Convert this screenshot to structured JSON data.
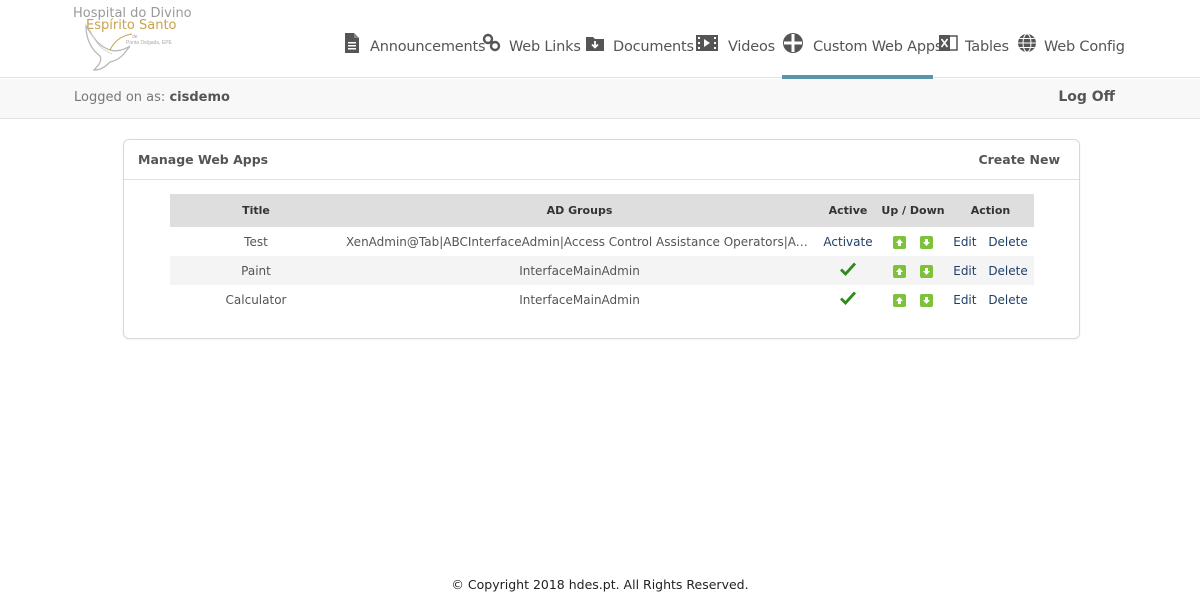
{
  "logo": {
    "line1": "Hospital do Divino",
    "line2": "Espírito Santo",
    "line3": "de",
    "line4": "Ponta Delgada, EPE"
  },
  "nav": [
    {
      "label": "Announcements",
      "icon": "document-icon",
      "active": false
    },
    {
      "label": "Web Links",
      "icon": "link-icon",
      "active": false
    },
    {
      "label": "Documents",
      "icon": "folder-download-icon",
      "active": false
    },
    {
      "label": "Videos",
      "icon": "film-icon",
      "active": false
    },
    {
      "label": "Custom Web Apps",
      "icon": "grid-circle-icon",
      "active": true
    },
    {
      "label": "Tables",
      "icon": "excel-icon",
      "active": false
    },
    {
      "label": "Web Config",
      "icon": "globe-icon",
      "active": false
    }
  ],
  "subheader": {
    "logged_prefix": "Logged on as:",
    "username": "cisdemo",
    "logoff": "Log Off"
  },
  "panel": {
    "title": "Manage Web Apps",
    "create_new": "Create New"
  },
  "table": {
    "headers": [
      "Title",
      "AD Groups",
      "Active",
      "Up / Down",
      "Action"
    ],
    "rows": [
      {
        "title": "Test",
        "groups": "XenAdmin@Tab|ABCInterfaceAdmin|Access Control Assistance Operators|Account ...",
        "active": "Activate",
        "is_active": false,
        "edit": "Edit",
        "delete": "Delete"
      },
      {
        "title": "Paint",
        "groups": "InterfaceMainAdmin",
        "active": "",
        "is_active": true,
        "edit": "Edit",
        "delete": "Delete"
      },
      {
        "title": "Calculator",
        "groups": "InterfaceMainAdmin",
        "active": "",
        "is_active": true,
        "edit": "Edit",
        "delete": "Delete"
      }
    ]
  },
  "footer": "© Copyright 2018 hdes.pt. All Rights Reserved.",
  "colors": {
    "accent": "#5b93a8",
    "arrow": "#7ec13a",
    "check": "#2f8a1e",
    "link": "#1f3f66"
  }
}
